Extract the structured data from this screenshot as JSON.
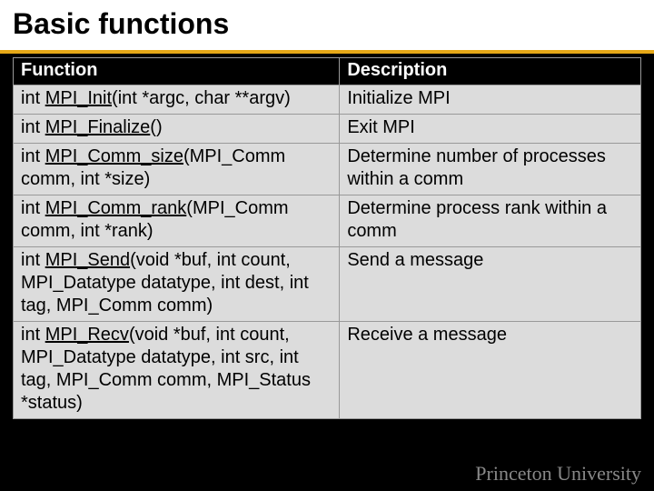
{
  "title": "Basic functions",
  "columns": {
    "func": "Function",
    "desc": "Description"
  },
  "rows": [
    {
      "pre": "int ",
      "name": "MPI_Init",
      "post": "(int *argc, char **argv)",
      "desc": "Initialize MPI"
    },
    {
      "pre": "int ",
      "name": "MPI_Finalize",
      "post": "()",
      "desc": "Exit MPI"
    },
    {
      "pre": "int ",
      "name": "MPI_Comm_size",
      "post": "(MPI_Comm comm, int *size)",
      "desc": "Determine number of processes within a comm"
    },
    {
      "pre": "int ",
      "name": "MPI_Comm_rank",
      "post": "(MPI_Comm comm, int *rank)",
      "desc": "Determine process rank within a comm"
    },
    {
      "pre": "int ",
      "name": "MPI_Send",
      "post": "(void *buf, int count, MPI_Datatype datatype, int dest, int tag, MPI_Comm comm)",
      "desc": "Send a message"
    },
    {
      "pre": "int ",
      "name": "MPI_Recv",
      "post": "(void *buf, int count, MPI_Datatype datatype, int src, int tag, MPI_Comm comm, MPI_Status *status)",
      "desc": "Receive a message"
    }
  ],
  "footer": "Princeton University"
}
